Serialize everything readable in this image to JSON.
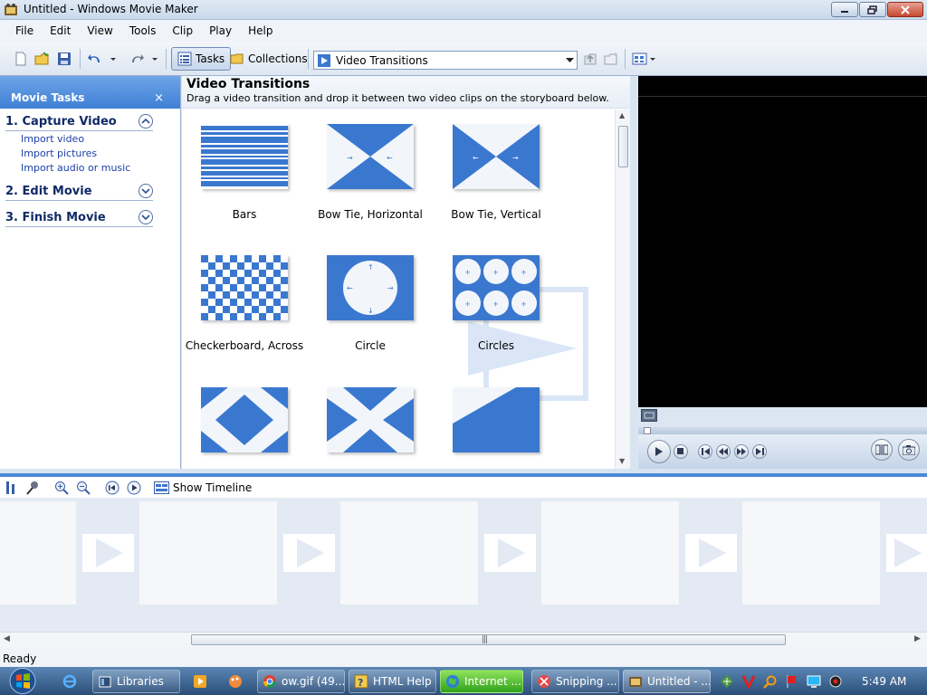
{
  "window": {
    "title": "Untitled - Windows Movie Maker"
  },
  "menu": [
    "File",
    "Edit",
    "View",
    "Tools",
    "Clip",
    "Play",
    "Help"
  ],
  "toolbar": {
    "tasks_label": "Tasks",
    "collections_label": "Collections",
    "collection_select": "Video Transitions"
  },
  "taskpane": {
    "header": "Movie Tasks",
    "close": "×",
    "groups": [
      {
        "title": "1. Capture Video",
        "links": [
          "Import video",
          "Import pictures",
          "Import audio or music"
        ]
      },
      {
        "title": "2. Edit Movie",
        "links": []
      },
      {
        "title": "3. Finish Movie",
        "links": []
      }
    ]
  },
  "content": {
    "title": "Video Transitions",
    "description": "Drag a video transition and drop it between two video clips on the storyboard below.",
    "transitions": [
      "Bars",
      "Bow Tie, Horizontal",
      "Bow Tie, Vertical",
      "Checkerboard, Across",
      "Circle",
      "Circles"
    ]
  },
  "storyboard": {
    "show_timeline_label": "Show Timeline"
  },
  "status": {
    "text": "Ready"
  },
  "taskbar": {
    "tasks": [
      "Libraries",
      "ow.gif (49...",
      "HTML Help",
      "Internet ...",
      "Snipping ...",
      "Untitled - ..."
    ],
    "clock": "5:49 AM"
  },
  "colors": {
    "accent": "#3f7fd6",
    "thumb_blue": "#3a78d0",
    "taskbar": "#2b4e78"
  }
}
